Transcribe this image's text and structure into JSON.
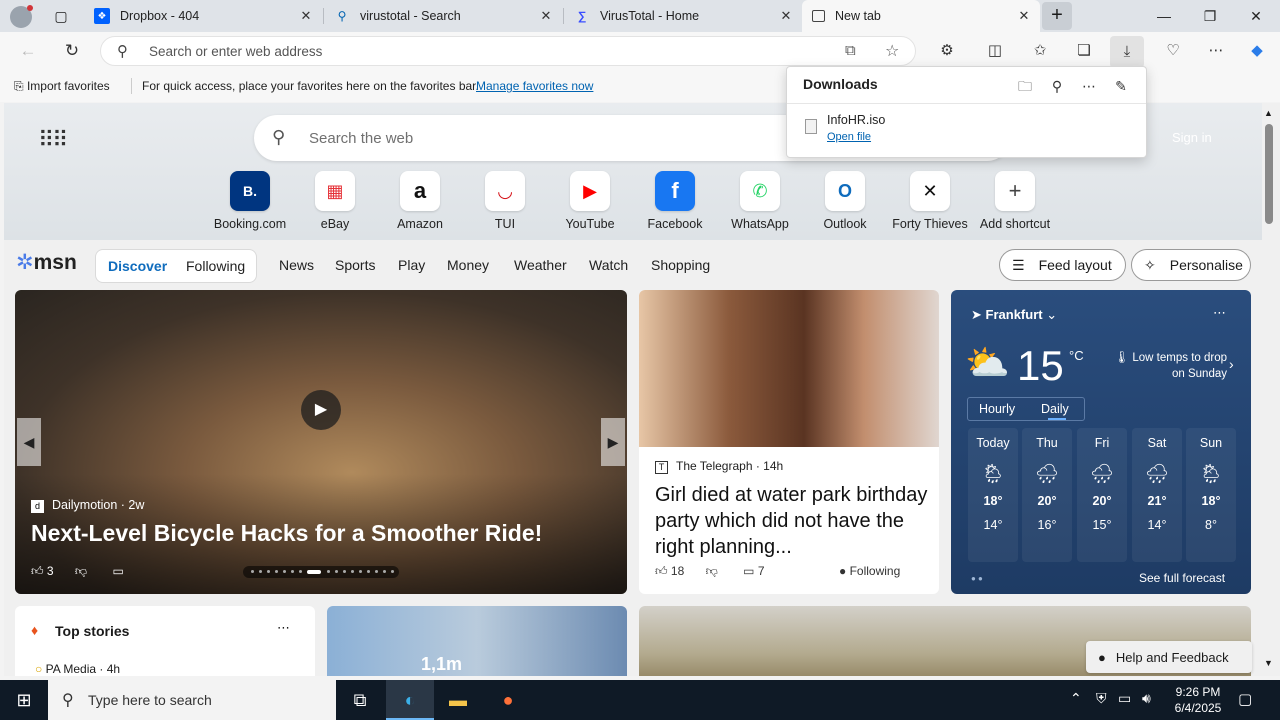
{
  "tabs": [
    {
      "label": "Dropbox - 404",
      "icon": "dropbox-icon"
    },
    {
      "label": "virustotal - Search",
      "icon": "search-icon"
    },
    {
      "label": "VirusTotal - Home",
      "icon": "virustotal-icon"
    },
    {
      "label": "New tab",
      "icon": "newtab-icon",
      "active": true
    }
  ],
  "address": {
    "placeholder": "Search or enter web address"
  },
  "favorites": {
    "import": "Import favorites",
    "message": "For quick access, place your favorites here on the favorites bar.",
    "manage_link": "Manage favorites now"
  },
  "downloads": {
    "title": "Downloads",
    "file_name": "InfoHR.iso",
    "open_file": "Open file"
  },
  "newtab": {
    "search_placeholder": "Search the web",
    "signin": "Sign in",
    "shortcuts": [
      {
        "label": "Booking.com",
        "glyph": "B.",
        "color": "#003580"
      },
      {
        "label": "eBay",
        "glyph": "▦",
        "color": "#e53238"
      },
      {
        "label": "Amazon",
        "glyph": "a",
        "color": "#111111"
      },
      {
        "label": "TUI",
        "glyph": "◡",
        "color": "#d40e14"
      },
      {
        "label": "YouTube",
        "glyph": "▶",
        "color": "#ff0000"
      },
      {
        "label": "Facebook",
        "glyph": "f",
        "color": "#1877f2"
      },
      {
        "label": "WhatsApp",
        "glyph": "✆",
        "color": "#25d366"
      },
      {
        "label": "Outlook",
        "glyph": "O",
        "color": "#0f6cbd"
      },
      {
        "label": "Forty Thieves",
        "glyph": "✕",
        "color": "#111111"
      },
      {
        "label": "Add shortcut",
        "glyph": "+",
        "color": "#444444"
      }
    ]
  },
  "msn": {
    "logo": "msn",
    "tab_discover": "Discover",
    "tab_following": "Following",
    "nav": [
      "News",
      "Sports",
      "Play",
      "Money",
      "Weather",
      "Watch",
      "Shopping"
    ],
    "feed_layout": "Feed layout",
    "personalise": "Personalise"
  },
  "video_card": {
    "source": "Dailymotion",
    "age": "2w",
    "title": "Next-Level Bicycle Hacks for a Smoother Ride!",
    "likes": "3"
  },
  "news_card": {
    "publisher": "The Telegraph",
    "age": "14h",
    "title": "Girl died at water park birthday party which did not have the right planning...",
    "likes": "18",
    "comments": "7",
    "following": "Following"
  },
  "weather": {
    "location": "Frankfurt",
    "temp": "15",
    "unit": "°C",
    "message": "Low temps to drop on Sunday",
    "toggle_hourly": "Hourly",
    "toggle_daily": "Daily",
    "days": [
      {
        "day": "Today",
        "hi": "18°",
        "lo": "14°",
        "icon": "sun-rain-icon"
      },
      {
        "day": "Thu",
        "hi": "20°",
        "lo": "16°",
        "icon": "cloud-rain-icon"
      },
      {
        "day": "Fri",
        "hi": "20°",
        "lo": "15°",
        "icon": "cloud-rain-icon"
      },
      {
        "day": "Sat",
        "hi": "21°",
        "lo": "14°",
        "icon": "cloud-rain-icon"
      },
      {
        "day": "Sun",
        "hi": "18°",
        "lo": "8°",
        "icon": "sun-rain-icon"
      }
    ],
    "full_forecast": "See full forecast"
  },
  "top_stories": {
    "title": "Top stories",
    "publisher": "PA Media",
    "age": "4h"
  },
  "image_caption": "1,1m",
  "feedback": "Help and Feedback",
  "taskbar": {
    "search_placeholder": "Type here to search",
    "time": "9:26 PM",
    "date": "6/4/2025"
  },
  "colors": {
    "accent": "#0f6cbd",
    "weather_bg": "#2a4d7d",
    "taskbar": "#0f1a26"
  }
}
